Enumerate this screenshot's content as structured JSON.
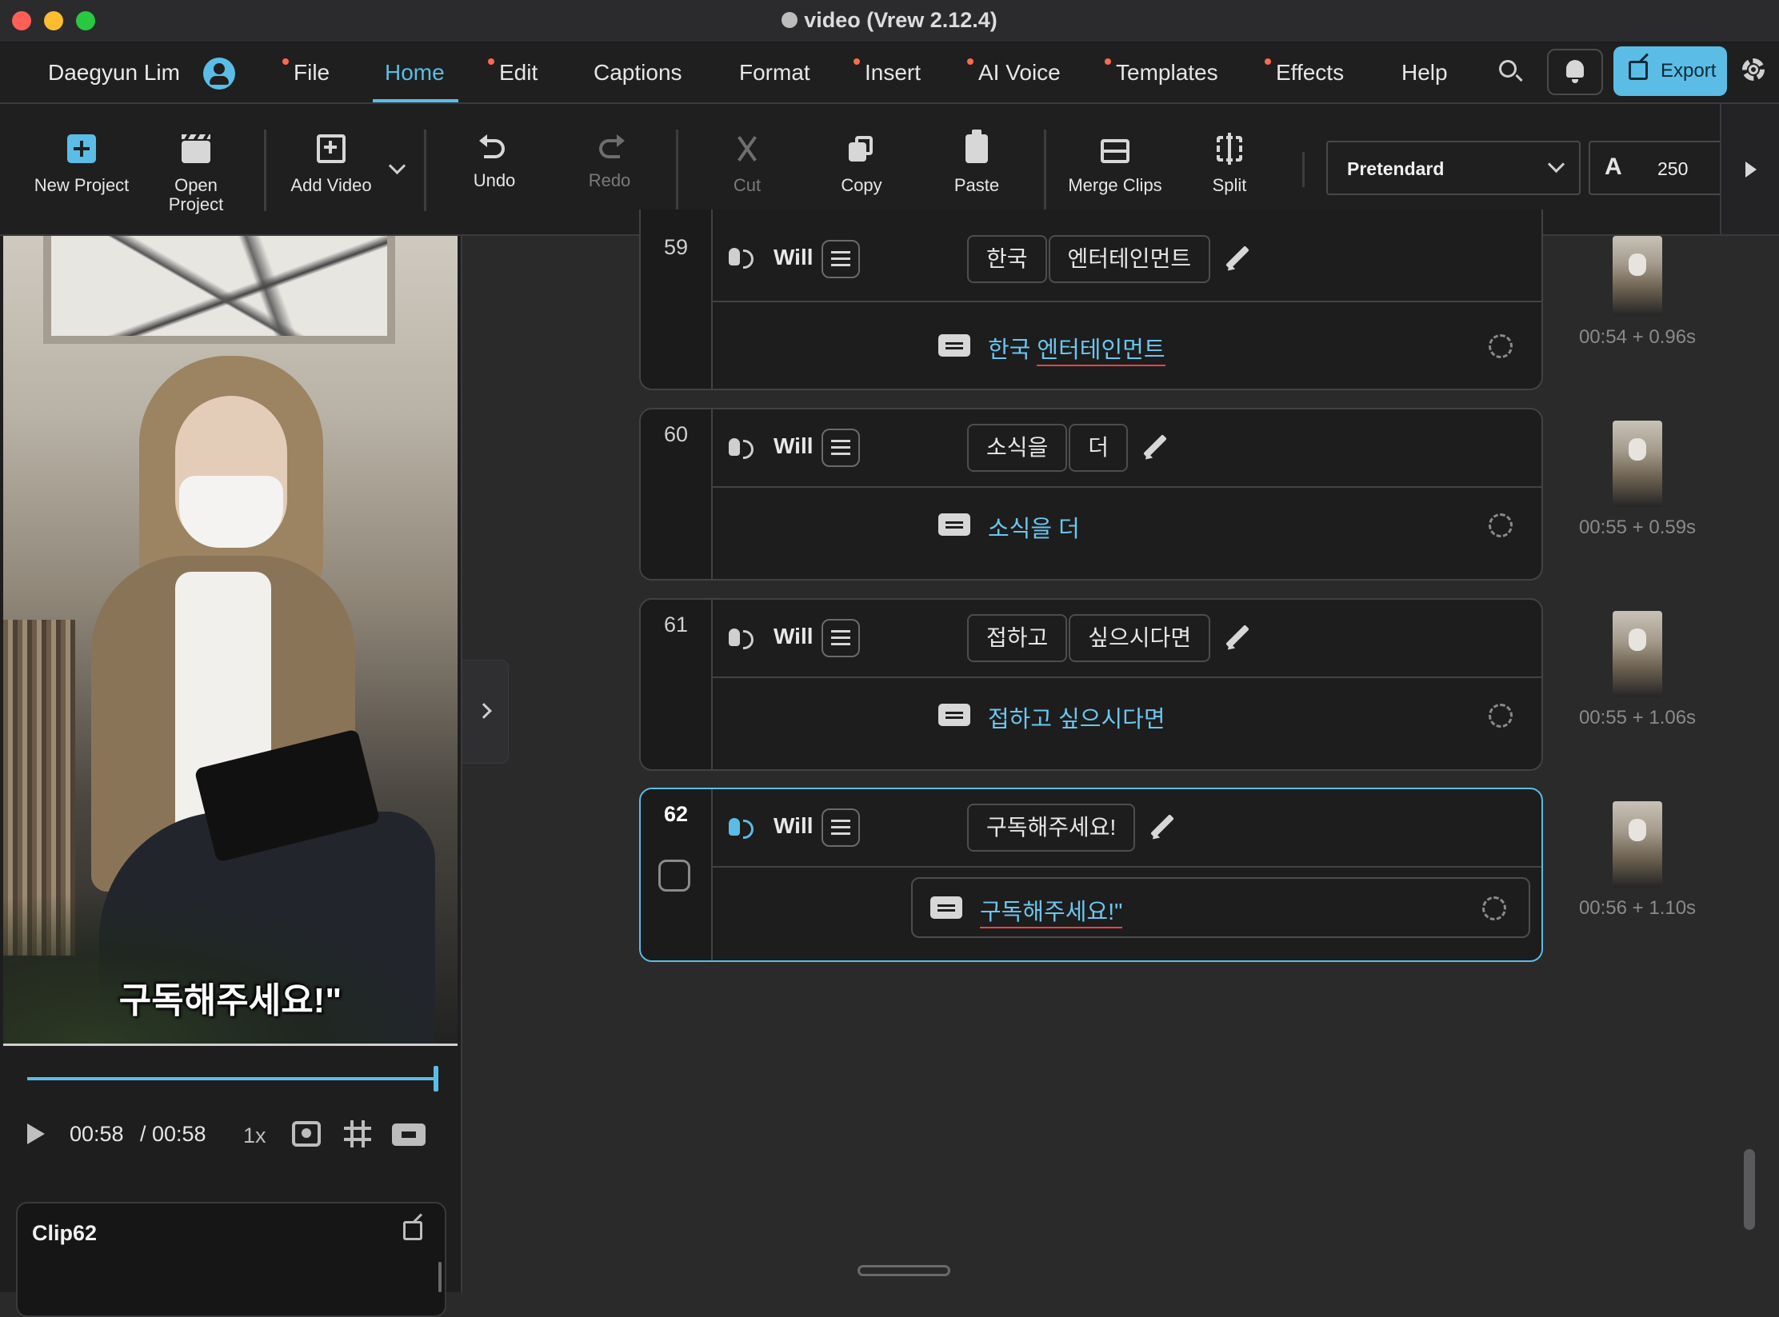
{
  "window": {
    "title": "video (Vrew 2.12.4)"
  },
  "menubar": {
    "user": "Daegyun Lim",
    "items": [
      {
        "label": "File",
        "badge": true
      },
      {
        "label": "Home",
        "badge": false,
        "active": true
      },
      {
        "label": "Edit",
        "badge": true
      },
      {
        "label": "Captions",
        "badge": false
      },
      {
        "label": "Format",
        "badge": false
      },
      {
        "label": "Insert",
        "badge": true
      },
      {
        "label": "AI Voice",
        "badge": true
      },
      {
        "label": "Templates",
        "badge": true
      },
      {
        "label": "Effects",
        "badge": true
      },
      {
        "label": "Help",
        "badge": false
      }
    ],
    "export_label": "Export",
    "accent": "#5bbde6"
  },
  "toolbar": {
    "new_project": "New Project",
    "open_project": "Open Project",
    "add_video": "Add Video",
    "undo": "Undo",
    "redo": "Redo",
    "cut": "Cut",
    "copy": "Copy",
    "paste": "Paste",
    "merge_clips": "Merge Clips",
    "split": "Split",
    "font": "Pretendard",
    "font_size": "250"
  },
  "player": {
    "subtitle": "구독해주세요!\"",
    "current_time": "00:58",
    "total_time": "/ 00:58",
    "speed": "1x",
    "progress": 1.0
  },
  "clip_panel": {
    "title": "Clip62"
  },
  "clips": [
    {
      "number": "59",
      "speaker": "Will",
      "words": [
        "한국",
        "엔터테인먼트"
      ],
      "caption_a": "한국 ",
      "caption_b": "엔터테인먼트",
      "time": "00:54 + 0.96s"
    },
    {
      "number": "60",
      "speaker": "Will",
      "words": [
        "소식을",
        "더"
      ],
      "caption_a": "소식을 더",
      "caption_b": "",
      "time": "00:55 + 0.59s"
    },
    {
      "number": "61",
      "speaker": "Will",
      "words": [
        "접하고",
        "싶으시다면"
      ],
      "caption_a": "접하고 싶으시다면",
      "caption_b": "",
      "time": "00:55 + 1.06s"
    },
    {
      "number": "62",
      "speaker": "Will",
      "words": [
        "구독해주세요!"
      ],
      "caption_a": "",
      "caption_b": "구독해주세요!\"",
      "time": "00:56 + 1.10s",
      "selected": true
    }
  ]
}
